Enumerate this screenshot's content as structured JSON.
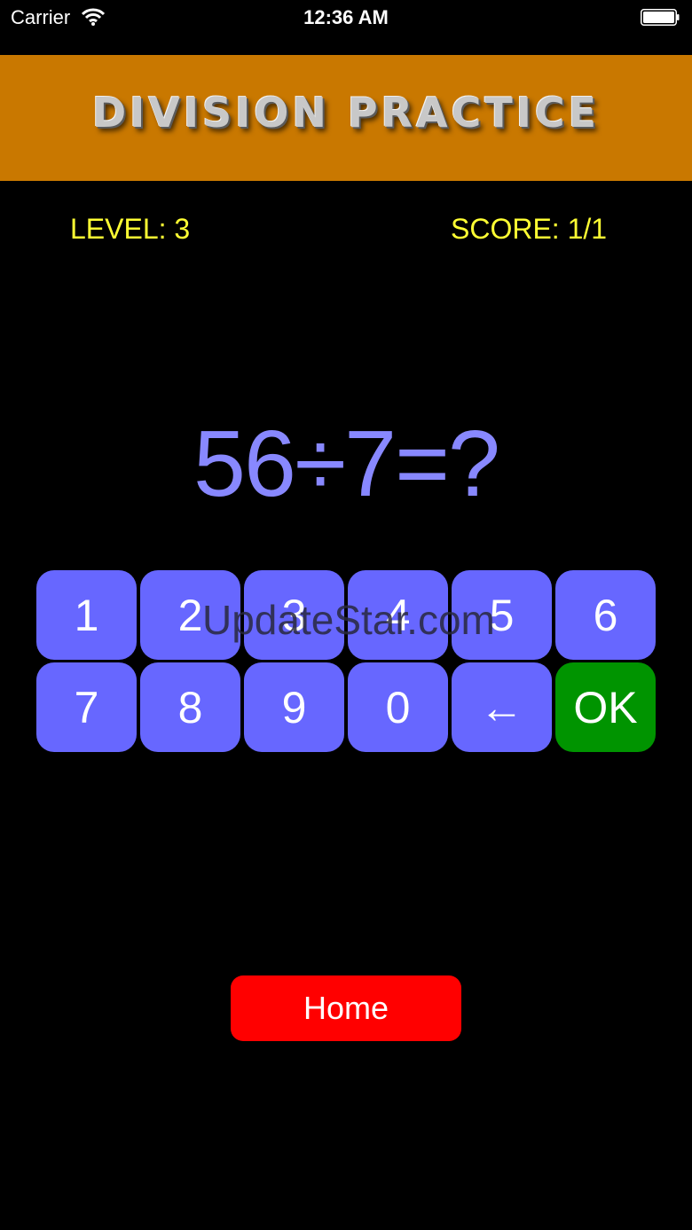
{
  "status_bar": {
    "carrier": "Carrier",
    "time": "12:36 AM"
  },
  "banner": {
    "title": "DIVISION PRACTICE",
    "background_color": "#c97800"
  },
  "hud": {
    "level": "LEVEL: 3",
    "score": "SCORE: 1/1",
    "color": "#ffff33"
  },
  "problem": {
    "text": "56÷7=?",
    "color": "#8888ff"
  },
  "keypad": {
    "keys": [
      "1",
      "2",
      "3",
      "4",
      "5",
      "6",
      "7",
      "8",
      "9",
      "0",
      "←",
      "OK"
    ],
    "key_color": "#6767ff",
    "ok_color": "#009400"
  },
  "watermark": "UpdateStar.com",
  "home_button": {
    "label": "Home",
    "color": "#ff0000"
  }
}
